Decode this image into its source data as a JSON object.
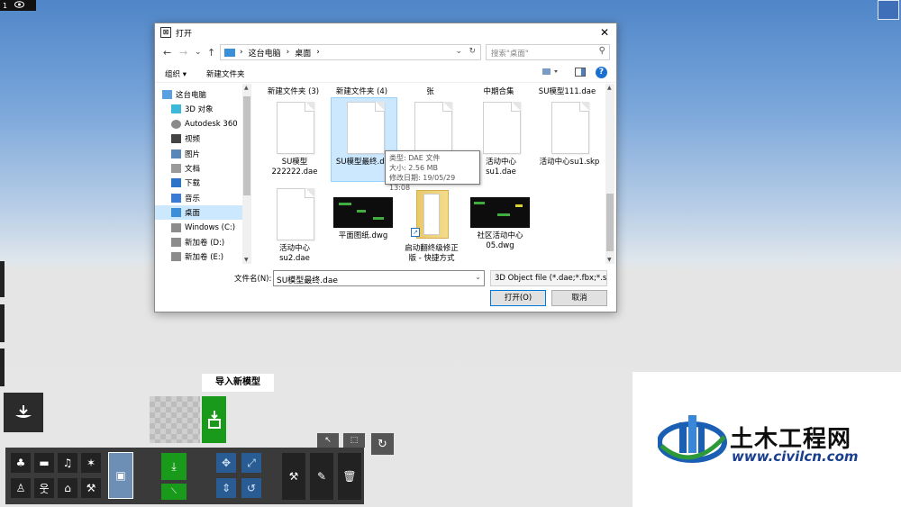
{
  "top_badge": {
    "number": "1",
    "icon": "eye-icon"
  },
  "dialog": {
    "title": "打开",
    "nav": {
      "back": "←",
      "forward": "→",
      "recent": "⌄",
      "up": "↑",
      "address_root": "这台电脑",
      "address_sep": "›",
      "address_current": "桌面",
      "search_placeholder": "搜索\"桌面\""
    },
    "toolbar": {
      "organize": "组织 ▾",
      "new_folder": "新建文件夹"
    },
    "tree": [
      {
        "label": "这台电脑",
        "icon": "computer-icon"
      },
      {
        "label": "3D 对象",
        "icon": "cube-icon"
      },
      {
        "label": "Autodesk 360",
        "icon": "cloud-icon"
      },
      {
        "label": "视频",
        "icon": "video-icon"
      },
      {
        "label": "图片",
        "icon": "picture-icon"
      },
      {
        "label": "文档",
        "icon": "document-icon"
      },
      {
        "label": "下载",
        "icon": "download-icon"
      },
      {
        "label": "音乐",
        "icon": "music-icon"
      },
      {
        "label": "桌面",
        "icon": "desktop-icon"
      },
      {
        "label": "Windows (C:)",
        "icon": "drive-icon"
      },
      {
        "label": "新加卷 (D:)",
        "icon": "drive-icon"
      },
      {
        "label": "新加卷 (E:)",
        "icon": "drive-icon"
      }
    ],
    "top_row_labels": [
      "新建文件夹 (3)",
      "新建文件夹 (4)",
      "张",
      "中期合集",
      "SU模型111.dae"
    ],
    "files": [
      {
        "name_line1": "SU模型",
        "name_line2": "222222.dae"
      },
      {
        "name_line1": "SU模型最终.dae",
        "name_line2": ""
      },
      {
        "name_line1": "",
        "name_line2": ""
      },
      {
        "name_line1": "活动中心",
        "name_line2": "su1.dae"
      },
      {
        "name_line1": "活动中心su1.skp",
        "name_line2": ""
      },
      {
        "name_line1": "活动中心",
        "name_line2": "su2.dae"
      },
      {
        "name_line1": "平面图纸.dwg",
        "name_line2": ""
      },
      {
        "name_line1": "启动翻终级修正",
        "name_line2": "版 - 快捷方式"
      },
      {
        "name_line1": "社区活动中心",
        "name_line2": "05.dwg"
      }
    ],
    "tooltip": {
      "type": "类型: DAE 文件",
      "size": "大小: 2.56 MB",
      "date": "修改日期: 19/05/29 13:08"
    },
    "filename_label": "文件名(N):",
    "filename_value": "SU模型最终.dae",
    "file_type": "3D Object file (*.dae;*.fbx;*.s",
    "open_button": "打开(O)",
    "cancel_button": "取消"
  },
  "bottom_ui": {
    "import_label": "导入新模型"
  },
  "watermark": {
    "brand": "土木工程网",
    "url": "www.civilcn.com"
  }
}
